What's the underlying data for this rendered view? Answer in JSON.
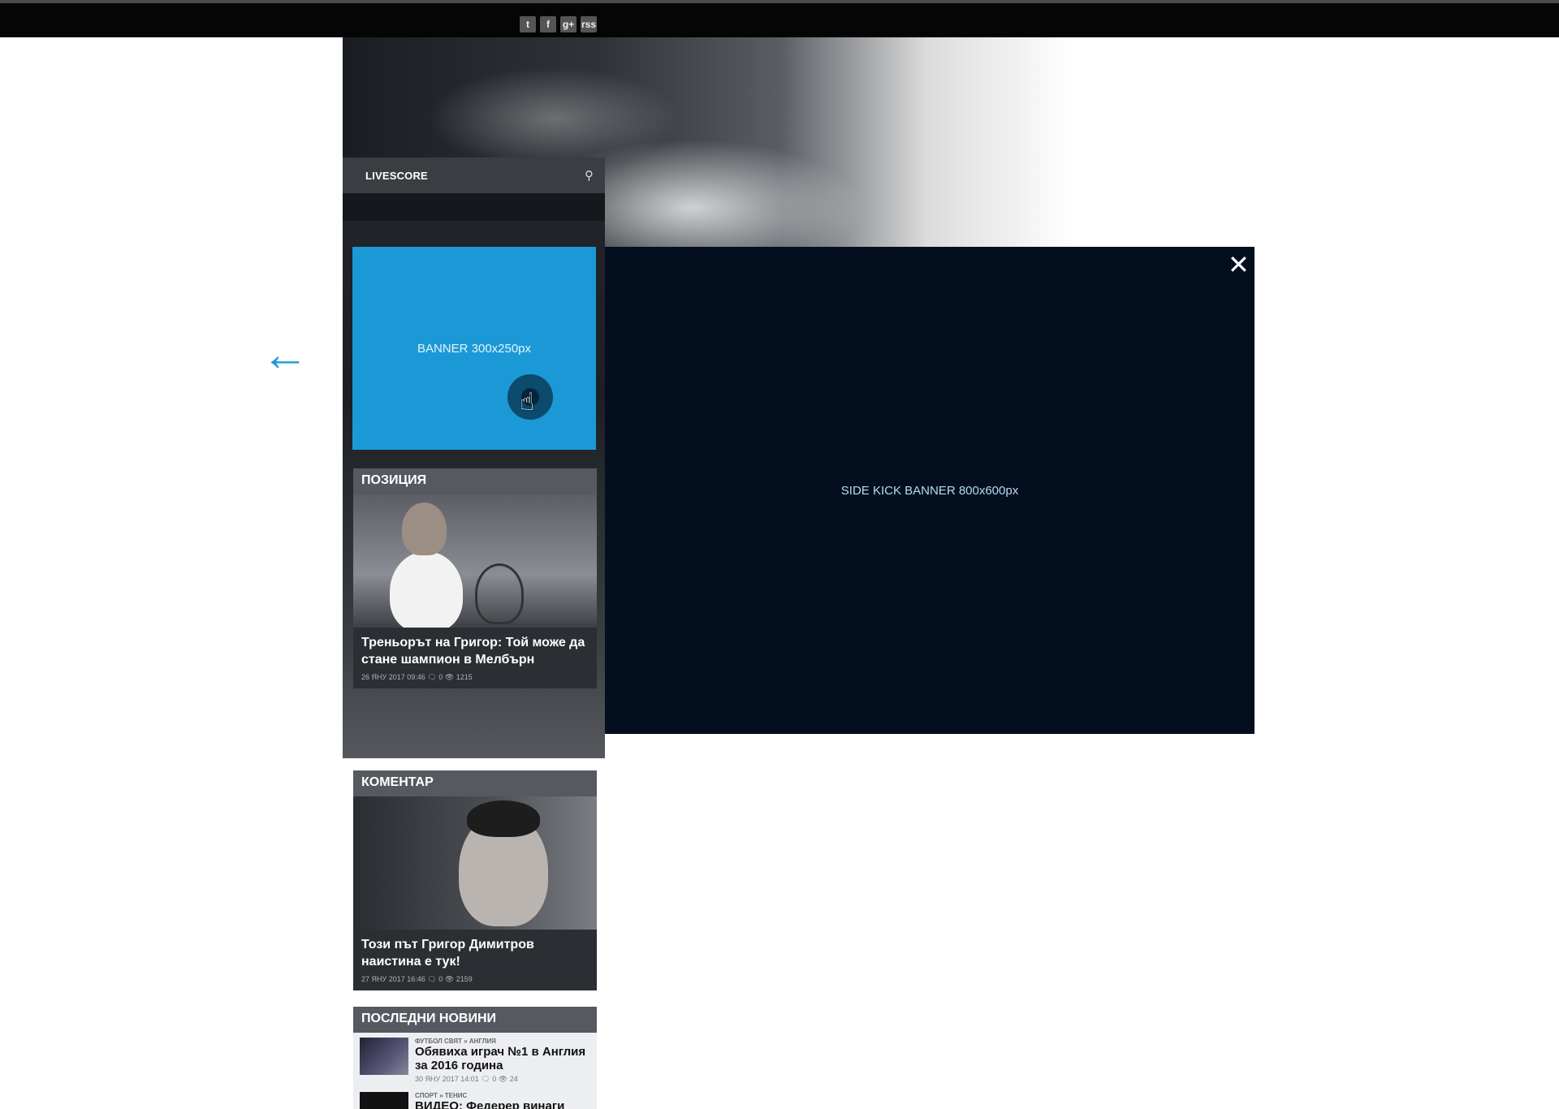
{
  "social": [
    "t",
    "f",
    "g+",
    "rss"
  ],
  "livescore": {
    "label": "LIVESCORE"
  },
  "banner_small": {
    "label": "BANNER 300x250px"
  },
  "sidekick": {
    "label": "SIDE KICK BANNER 800x600px"
  },
  "cards": [
    {
      "section": "ПОЗИЦИЯ",
      "title": "Треньорът на Григор: Той може да стане шампион в Мелбърн",
      "date": "26 ЯНУ 2017 09:46",
      "comments": "0",
      "views": "1215"
    },
    {
      "section": "КОМЕНТАР",
      "title": "Този път Григор Димитров наистина е тук!",
      "date": "27 ЯНУ 2017 16:46",
      "comments": "0",
      "views": "2159"
    }
  ],
  "latest": {
    "section": "ПОСЛЕДНИ НОВИНИ",
    "items": [
      {
        "category": "ФУТБОЛ СВЯТ » АНГЛИЯ",
        "title": "Обявиха играч №1 в Англия за 2016 година",
        "date": "30 ЯНУ 2017 14:01",
        "comments": "0",
        "views": "24"
      },
      {
        "category": "СПОРТ » ТЕНИС",
        "title": "ВИДЕО: Федерер винаги намира"
      }
    ]
  },
  "icons": {
    "twitter": "twitter-icon",
    "facebook": "facebook-icon",
    "google": "google-plus-icon",
    "rss": "rss-icon",
    "search": "search-icon",
    "close": "close-icon",
    "back": "arrow-left-icon"
  },
  "colors": {
    "accent": "#1b99d6",
    "sidekick_bg": "#030f1f",
    "topbar": "#050505"
  }
}
